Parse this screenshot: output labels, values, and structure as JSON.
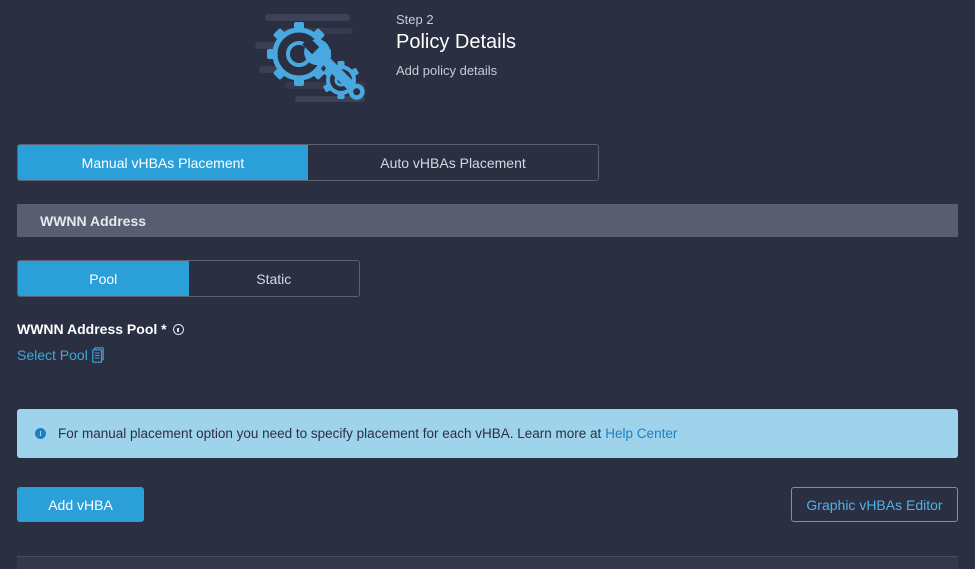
{
  "step": {
    "label": "Step 2",
    "title": "Policy Details",
    "subtitle": "Add policy details"
  },
  "placement_toggle": {
    "options": [
      "Manual vHBAs Placement",
      "Auto vHBAs Placement"
    ],
    "selected": "Manual vHBAs Placement"
  },
  "section": {
    "title": "WWNN Address"
  },
  "address_type_toggle": {
    "options": [
      "Pool",
      "Static"
    ],
    "selected": "Pool"
  },
  "pool_field": {
    "label": "WWNN Address Pool *",
    "action": "Select Pool"
  },
  "banner": {
    "text": "For manual placement option you need to specify placement for each vHBA. Learn more at",
    "link": "Help Center"
  },
  "buttons": {
    "add": "Add vHBA",
    "editor": "Graphic vHBAs Editor"
  },
  "icons": {
    "header": "gear-wrench-illustration-icon",
    "info": "info-icon",
    "doc": "document-icon"
  },
  "colors": {
    "background": "#2b2f42",
    "accent": "#2a9fd8",
    "link": "#3aa7e0",
    "section_bar": "#585d70",
    "banner_bg": "#9fd3ec"
  }
}
